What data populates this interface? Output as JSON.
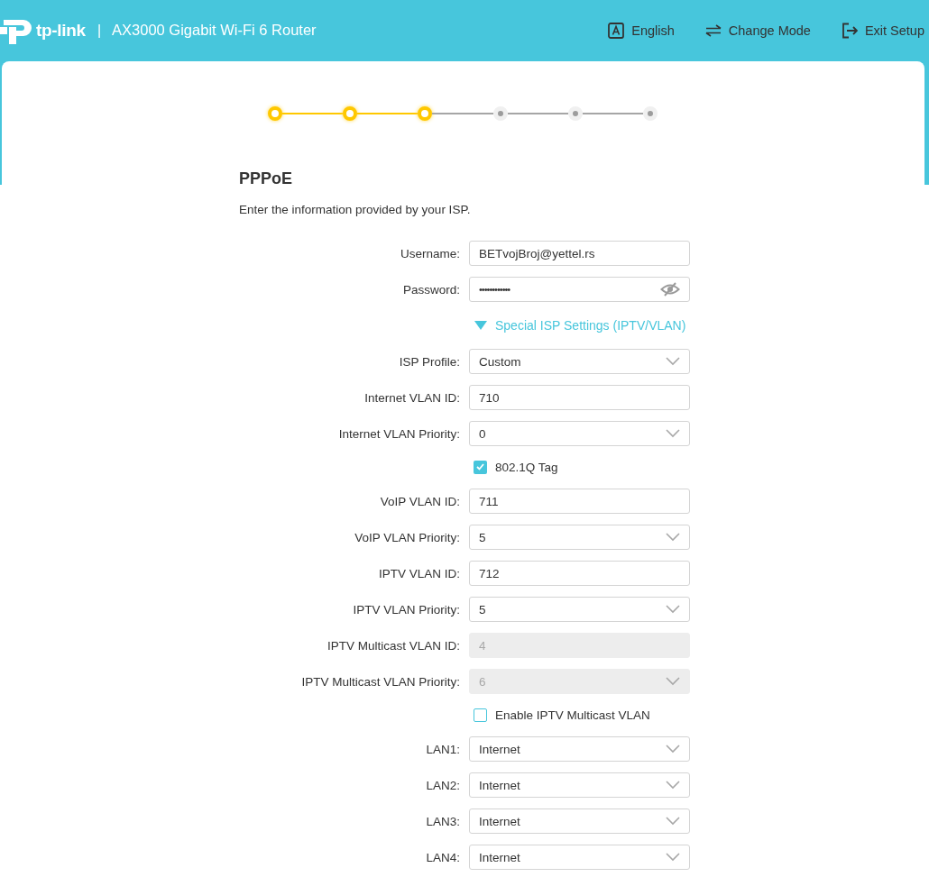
{
  "header": {
    "logo_text": "tp-link",
    "separator": "|",
    "title": "AX3000 Gigabit Wi-Fi 6 Router",
    "actions": [
      {
        "kind": "language",
        "label": "English"
      },
      {
        "kind": "mode",
        "label": "Change Mode"
      },
      {
        "kind": "exit",
        "label": "Exit Setup"
      }
    ]
  },
  "stepper": [
    {
      "done": true
    },
    {
      "done": true
    },
    {
      "done": true
    },
    {
      "done": false
    },
    {
      "done": false
    },
    {
      "done": false
    }
  ],
  "section": {
    "title": "PPPoE",
    "description": "Enter the information provided by your ISP."
  },
  "form": [
    {
      "kind": "text",
      "label": "Username:",
      "value": "BETvojBroj@yettel.rs",
      "disabled": false
    },
    {
      "kind": "password",
      "label": "Password:",
      "value": "••••••••••••",
      "disabled": false
    },
    {
      "kind": "toggle",
      "label": "Special ISP Settings (IPTV/VLAN)",
      "expanded": true
    },
    {
      "kind": "select",
      "label": "ISP Profile:",
      "value": "Custom",
      "disabled": false
    },
    {
      "kind": "text",
      "label": "Internet VLAN ID:",
      "value": "710",
      "disabled": false
    },
    {
      "kind": "select",
      "label": "Internet VLAN Priority:",
      "value": "0",
      "disabled": false
    },
    {
      "kind": "checkbox",
      "label": "802.1Q Tag",
      "checked": true
    },
    {
      "kind": "text",
      "label": "VoIP VLAN ID:",
      "value": "711",
      "disabled": false
    },
    {
      "kind": "select",
      "label": "VoIP VLAN Priority:",
      "value": "5",
      "disabled": false
    },
    {
      "kind": "text",
      "label": "IPTV VLAN ID:",
      "value": "712",
      "disabled": false
    },
    {
      "kind": "select",
      "label": "IPTV VLAN Priority:",
      "value": "5",
      "disabled": false
    },
    {
      "kind": "text",
      "label": "IPTV Multicast VLAN ID:",
      "value": "4",
      "disabled": true
    },
    {
      "kind": "select",
      "label": "IPTV Multicast VLAN Priority:",
      "value": "6",
      "disabled": true
    },
    {
      "kind": "checkbox",
      "label": "Enable IPTV Multicast VLAN",
      "checked": false
    },
    {
      "kind": "select",
      "label": "LAN1:",
      "value": "Internet",
      "disabled": false
    },
    {
      "kind": "select",
      "label": "LAN2:",
      "value": "Internet",
      "disabled": false
    },
    {
      "kind": "select",
      "label": "LAN3:",
      "value": "Internet",
      "disabled": false
    },
    {
      "kind": "select",
      "label": "LAN4:",
      "value": "Internet",
      "disabled": false
    }
  ]
}
